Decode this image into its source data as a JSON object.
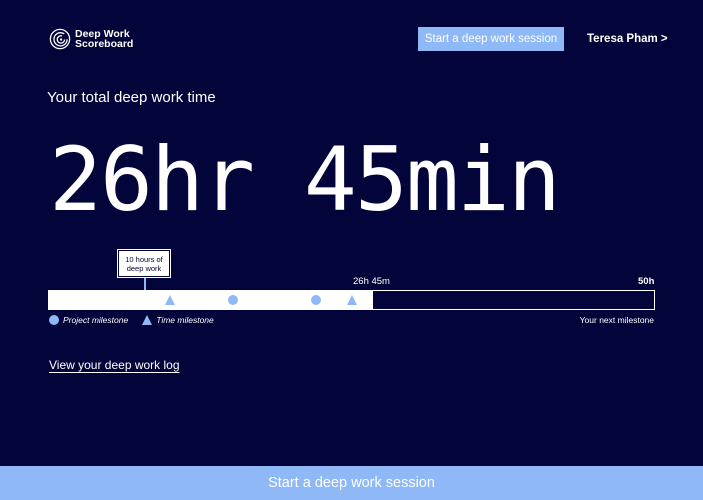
{
  "header": {
    "logo_line1": "Deep Work",
    "logo_line2": "Scoreboard",
    "logo_icon": "spiral-icon",
    "cta_label": "Start a deep work session",
    "user_label": "Teresa Pham >"
  },
  "main": {
    "title": "Your total deep work time",
    "total_display": "26hr 45min"
  },
  "progress": {
    "current_label": "26h 45m",
    "goal_label": "50h",
    "current_hours": 26.75,
    "goal_hours": 50,
    "tooltip_line1": "10 hours of",
    "tooltip_line2": "deep work",
    "tooltip_hours": 10,
    "milestones": [
      {
        "type": "time",
        "hours": 10
      },
      {
        "type": "project",
        "hours": 15.2
      },
      {
        "type": "project",
        "hours": 22.1
      },
      {
        "type": "time",
        "hours": 25
      }
    ],
    "legend_project": "Project milestone",
    "legend_time": "Time milestone",
    "next_milestone_label": "Your next milestone"
  },
  "links": {
    "log_label": "View your deep work log"
  },
  "footer": {
    "cta_label": "Start a deep work session"
  },
  "colors": {
    "background": "#03043a",
    "accent": "#8fb8f7",
    "text": "#ffffff"
  }
}
